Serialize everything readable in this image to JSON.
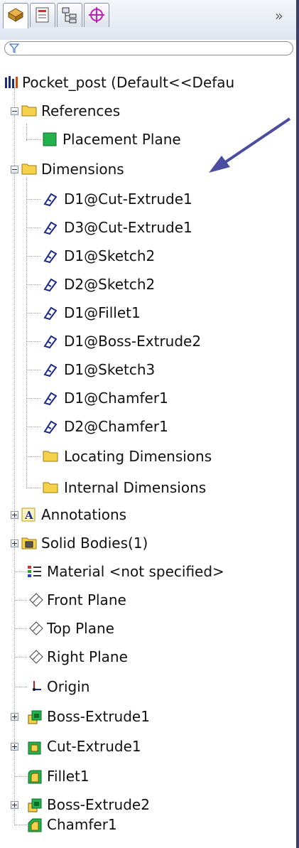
{
  "toolbar": {
    "tabs": [
      "feature-manager",
      "property-manager",
      "configuration-manager",
      "dimxpert-manager"
    ],
    "overflow_glyph": "»"
  },
  "tree": {
    "root": "Pocket_post  (Default<<Defau",
    "references": "References",
    "placement_plane": "Placement Plane",
    "dimensions": "Dimensions",
    "dims": [
      "D1@Cut-Extrude1",
      "D3@Cut-Extrude1",
      "D1@Sketch2",
      "D2@Sketch2",
      "D1@Fillet1",
      "D1@Boss-Extrude2",
      "D1@Sketch3",
      "D1@Chamfer1",
      "D2@Chamfer1"
    ],
    "locating_dimensions": "Locating Dimensions",
    "internal_dimensions": "Internal Dimensions",
    "annotations": "Annotations",
    "solid_bodies": "Solid Bodies(1)",
    "material": "Material <not specified>",
    "front_plane": "Front Plane",
    "top_plane": "Top Plane",
    "right_plane": "Right Plane",
    "origin": "Origin",
    "boss_extrude1": "Boss-Extrude1",
    "cut_extrude1": "Cut-Extrude1",
    "fillet1": "Fillet1",
    "boss_extrude2": "Boss-Extrude2",
    "chamfer1": "Chamfer1"
  },
  "colors": {
    "frame": "#3d3e6c",
    "arrow": "#4b4da0",
    "folder": "#f5d24a",
    "green": "#22b14c"
  }
}
